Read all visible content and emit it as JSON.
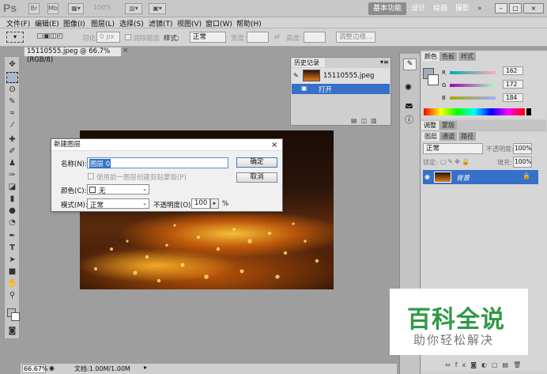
{
  "app": {
    "logo": "Ps",
    "zoom": "100%",
    "workspaces": [
      "基本功能",
      "设计",
      "绘画",
      "摄影"
    ],
    "more": "»",
    "window_buttons": [
      "–",
      "□",
      "×"
    ]
  },
  "menu": [
    "文件(F)",
    "编辑(E)",
    "图像(I)",
    "图层(L)",
    "选择(S)",
    "滤镜(T)",
    "视图(V)",
    "窗口(W)",
    "帮助(H)"
  ],
  "options": {
    "feather_label": "羽化:",
    "feather_value": "0 px",
    "antialias_label": "消除锯齿",
    "style_label": "样式:",
    "style_value": "正常",
    "width_label": "宽度:",
    "height_label": "高度:",
    "refine_edge": "调整边缘..."
  },
  "document": {
    "tab_title": "15110555.jpeg @ 66.7%(RGB/8)",
    "close": "×"
  },
  "status": {
    "zoom": "66.67%",
    "doc_info": "文档:1.00M/1.00M"
  },
  "history_panel": {
    "tab": "历史记录",
    "snapshot_name": "15110555.jpeg",
    "step": "打开"
  },
  "color_panel": {
    "tabs": [
      "颜色",
      "色板",
      "样式"
    ],
    "r": "162",
    "g": "172",
    "b": "184",
    "fg_color": "#a2acb8"
  },
  "adjust_panel": {
    "tabs": [
      "调整",
      "蒙版"
    ]
  },
  "layers_panel": {
    "tabs": [
      "图层",
      "通道",
      "路径"
    ],
    "blend_mode": "正常",
    "opacity_label": "不透明度:",
    "opacity_value": "100%",
    "lock_label": "锁定:",
    "fill_label": "填充:",
    "fill_value": "100%",
    "layer_name": "背景"
  },
  "dialog": {
    "title": "新建图层",
    "name_label": "名称(N):",
    "name_value": "图层 0",
    "clip_label": "使用前一图层创建剪贴蒙版(P)",
    "color_label": "颜色(C):",
    "color_value": "无",
    "mode_label": "模式(M):",
    "mode_value": "正常",
    "opacity_label": "不透明度(O):",
    "opacity_value": "100",
    "percent": "%",
    "ok": "确定",
    "cancel": "取消",
    "close": "×"
  },
  "watermark": {
    "main": "百科全说",
    "sub": "助你轻松解决"
  }
}
